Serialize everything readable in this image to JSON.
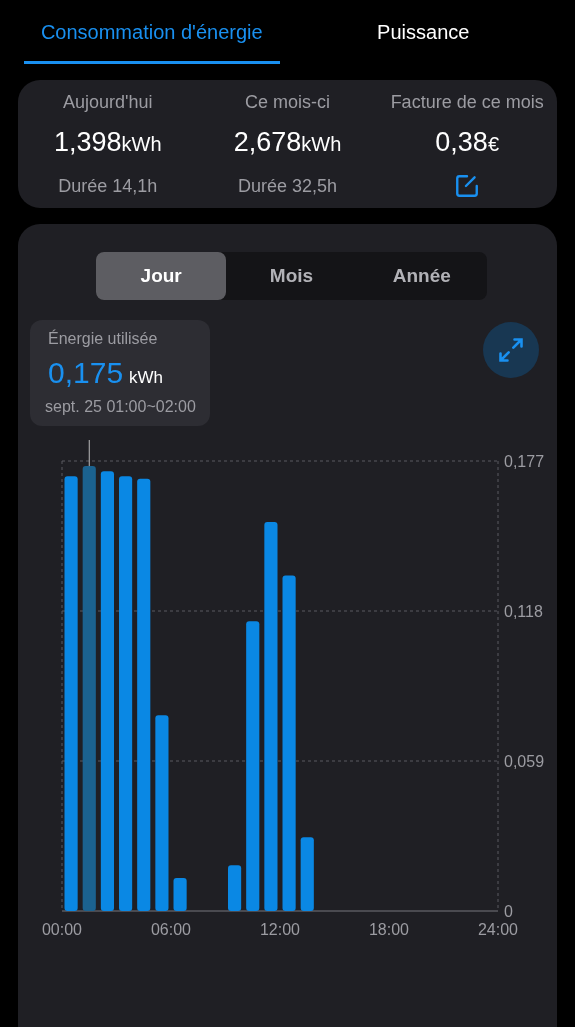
{
  "tabs": [
    {
      "label": "Consommation d'énergie",
      "selected": true
    },
    {
      "label": "Puissance",
      "selected": false
    }
  ],
  "summary": [
    {
      "title": "Aujourd'hui",
      "value": "1,398",
      "unit": "kWh",
      "footer": "Durée 14,1h",
      "kind": "text"
    },
    {
      "title": "Ce mois-ci",
      "value": "2,678",
      "unit": "kWh",
      "footer": "Durée 32,5h",
      "kind": "text"
    },
    {
      "title": "Facture de ce mois",
      "value": "0,38",
      "unit": "€",
      "kind": "edit"
    }
  ],
  "periods": [
    {
      "label": "Jour",
      "selected": true
    },
    {
      "label": "Mois",
      "selected": false
    },
    {
      "label": "Année",
      "selected": false
    }
  ],
  "tooltip": {
    "title": "Énergie utilisée",
    "value": "0,175",
    "unit": "kWh",
    "time": "sept. 25 01:00~02:00"
  },
  "chart_data": {
    "type": "bar",
    "x": [
      0.5,
      1.5,
      2.5,
      3.5,
      4.5,
      5.5,
      6.5,
      7.5,
      8.5,
      9.5,
      10.5,
      11.5,
      12.5,
      13.5
    ],
    "series": [
      {
        "color": "#0a88e4",
        "values": [
          0.171,
          null,
          0.173,
          0.171,
          0.17,
          0.077,
          0.013,
          null,
          null,
          0.018,
          0.114,
          0.153,
          0.132,
          0.029
        ]
      },
      {
        "color": "#1b628f",
        "values": [
          null,
          0.175,
          null,
          null,
          null,
          null,
          null,
          null,
          null,
          null,
          null,
          null,
          null,
          null
        ]
      }
    ],
    "xlim": [
      0,
      24
    ],
    "ylim": [
      0,
      0.177
    ],
    "xticks": [
      {
        "value": 0,
        "label": "00:00"
      },
      {
        "value": 6,
        "label": "06:00"
      },
      {
        "value": 12,
        "label": "12:00"
      },
      {
        "value": 18,
        "label": "18:00"
      },
      {
        "value": 24,
        "label": "24:00"
      }
    ],
    "yticks": [
      {
        "value": 0,
        "label": "0"
      },
      {
        "value": 0.059,
        "label": "0,059"
      },
      {
        "value": 0.118,
        "label": "0,118"
      },
      {
        "value": 0.177,
        "label": "0,177"
      }
    ]
  }
}
